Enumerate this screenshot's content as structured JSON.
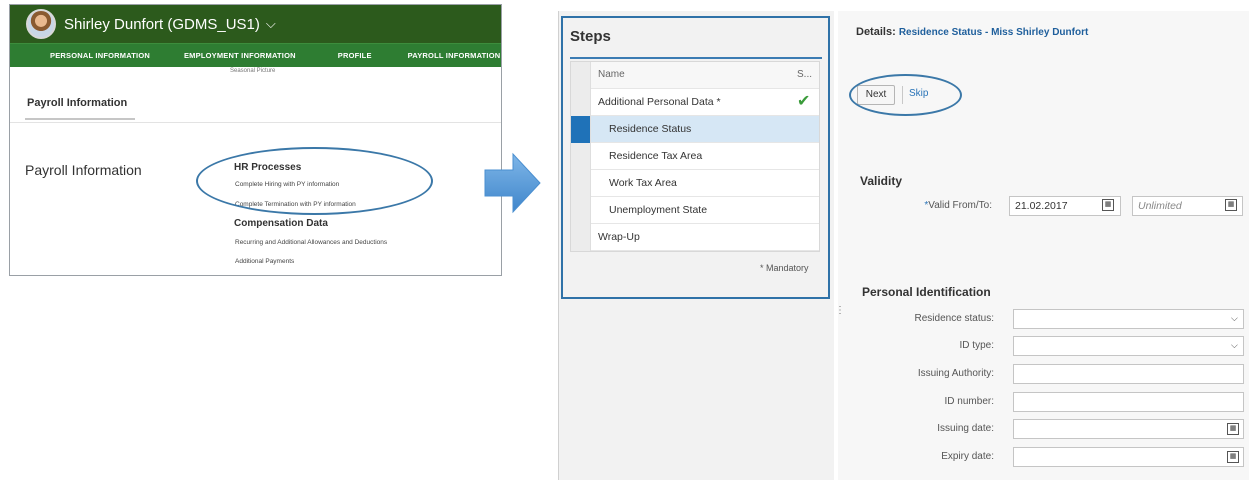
{
  "sf": {
    "user": "Shirley Dunfort (GDMS_US1)",
    "nav": [
      "PERSONAL INFORMATION",
      "EMPLOYMENT INFORMATION",
      "PROFILE",
      "PAYROLL INFORMATION"
    ],
    "sub_label": "Seasonal Picture",
    "tab": "Payroll Information",
    "section_title": "Payroll Information",
    "hr_title": "HR Processes",
    "hr_links": [
      "Complete Hiring with PY information",
      "Complete Termination with PY information"
    ],
    "comp_title": "Compensation Data",
    "comp_links": [
      "Recurring and Additional Allowances and Deductions",
      "Additional Payments"
    ]
  },
  "steps": {
    "title": "Steps",
    "col_name": "Name",
    "col_status": "S...",
    "rows": [
      "Additional Personal Data *",
      "Residence Status",
      "Residence Tax Area",
      "Work Tax Area",
      "Unemployment State",
      "Wrap-Up"
    ],
    "mandatory": "* Mandatory"
  },
  "details": {
    "title_prefix": "Details:",
    "title_value": "Residence Status - Miss Shirley Dunfort",
    "next": "Next",
    "skip": "Skip",
    "validity_title": "Validity",
    "valid_label": "Valid From/To:",
    "valid_from": "21.02.2017",
    "valid_to": "Unlimited",
    "pid_title": "Personal Identification",
    "fields": [
      {
        "label": "Residence status:"
      },
      {
        "label": "ID type:"
      },
      {
        "label": "Issuing Authority:"
      },
      {
        "label": "ID number:"
      },
      {
        "label": "Issuing date:"
      },
      {
        "label": "Expiry date:"
      }
    ]
  },
  "icons": {
    "checkmark": "check-icon",
    "calendar": "calendar-icon",
    "dropdown": "chevron-down-icon",
    "arrow": "arrow-right-icon"
  },
  "colors": {
    "sf_header": "#2c5a1c",
    "sf_nav": "#2e7d32",
    "highlight_blue": "#2f72a8",
    "selected_row": "#d6e7f5",
    "check_green": "#3a9b3a"
  }
}
